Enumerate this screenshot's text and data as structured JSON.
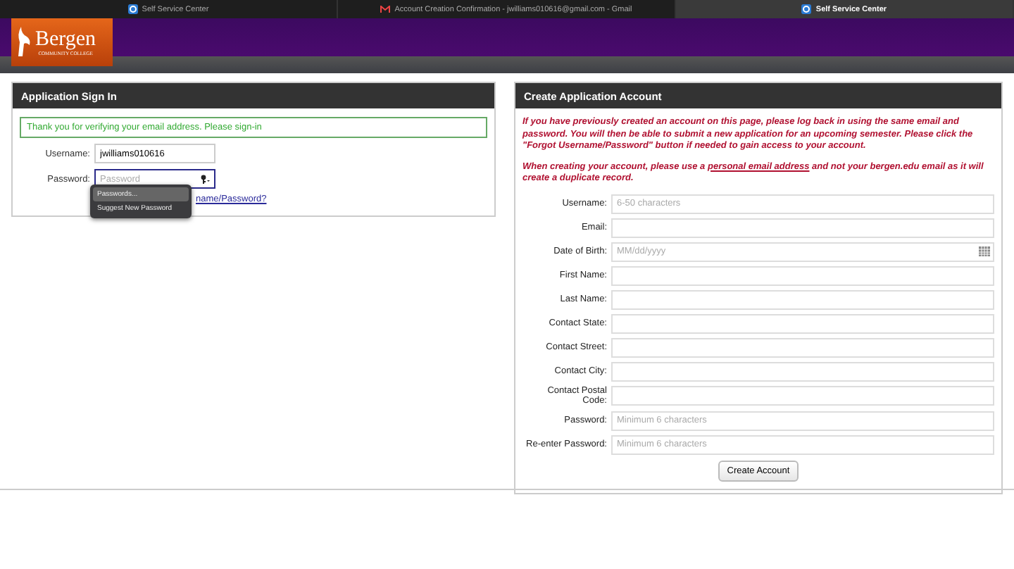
{
  "browser_tabs": [
    {
      "label": "Self Service Center",
      "kind": "app",
      "selected": false
    },
    {
      "label": "Account Creation Confirmation - jwilliams010616@gmail.com - Gmail",
      "kind": "mail",
      "selected": false
    },
    {
      "label": "Self Service Center",
      "kind": "app",
      "selected": true
    }
  ],
  "logo": {
    "name": "Bergen",
    "subtitle": "COMMUNITY COLLEGE"
  },
  "sign_in": {
    "title": "Application Sign In",
    "message": "Thank you for verifying your email address. Please sign-in",
    "fields": [
      {
        "label": "Username:",
        "value": "jwilliams010616",
        "focused": false
      },
      {
        "label": "Password:",
        "placeholder": "Password",
        "focused": true
      }
    ],
    "link": "name/Password?",
    "autofill_menu": [
      {
        "label": "Passwords...",
        "selected": true
      },
      {
        "label": "Suggest New Password",
        "selected": false
      }
    ]
  },
  "create_account": {
    "title": "Create Application Account",
    "notice": "If you have previously created an account on this page, please log back in using the same email and password.  You will then be able to submit a new application for an upcoming semester.  Please click the \"Forgot Username/Password\" button if needed to gain access to your account.",
    "warning": {
      "before": "When creating your account, please use a ",
      "link": "personal email address",
      "after": " and not your bergen.edu email as it will create a duplicate record."
    },
    "fields": [
      {
        "label": "Username:",
        "placeholder": "6-50 characters",
        "kind": "text"
      },
      {
        "label": "Email:",
        "kind": "text"
      },
      {
        "label": "Date of Birth:",
        "placeholder": "MM/dd/yyyy",
        "kind": "date"
      },
      {
        "label": "First Name:",
        "kind": "text"
      },
      {
        "label": "Last Name:",
        "kind": "text"
      },
      {
        "label": "Contact State:",
        "kind": "text"
      },
      {
        "label": "Contact Street:",
        "kind": "text"
      },
      {
        "label": "Contact City:",
        "kind": "text"
      },
      {
        "label": "Contact Postal Code:",
        "kind": "text"
      },
      {
        "label": "Password:",
        "placeholder": "Minimum 6 characters",
        "kind": "text"
      },
      {
        "label": "Re-enter Password:",
        "placeholder": "Minimum 6 characters",
        "kind": "text"
      }
    ],
    "button": "Create Account"
  }
}
